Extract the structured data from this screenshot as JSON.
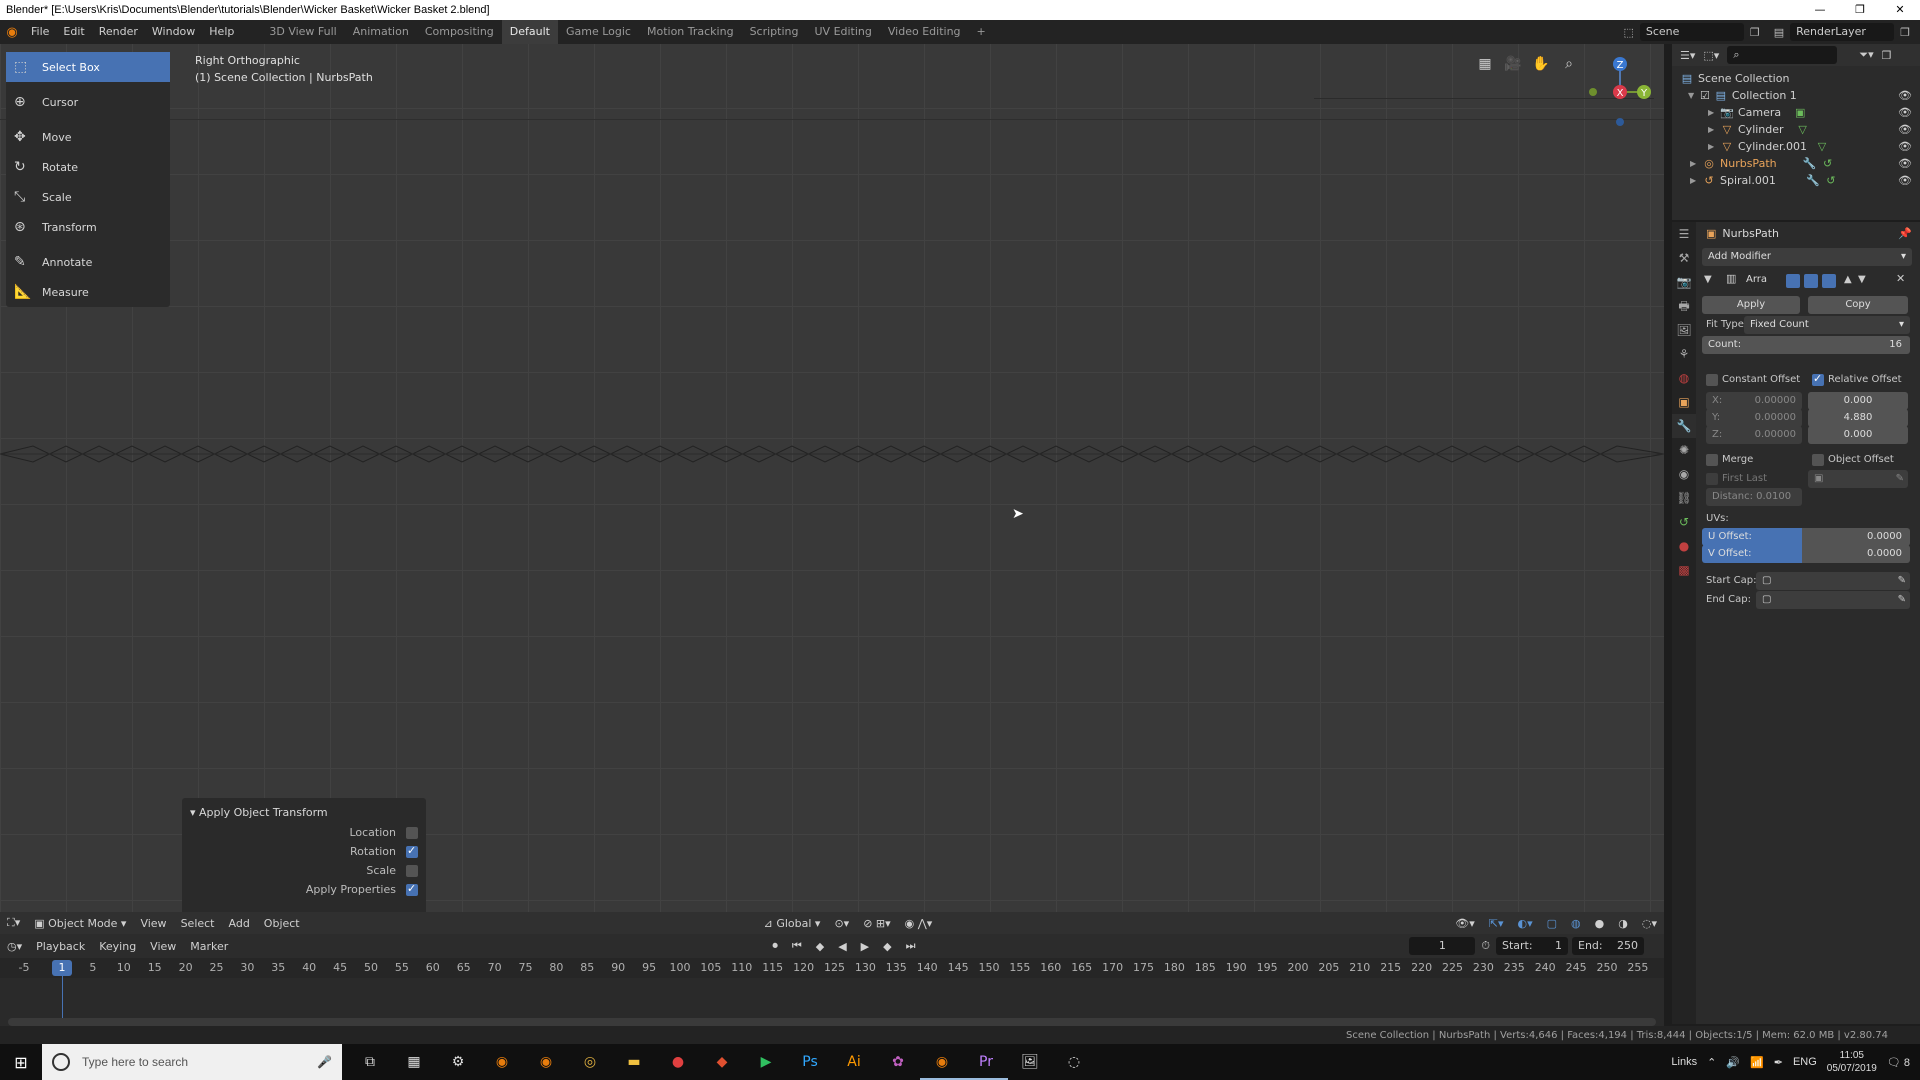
{
  "window": {
    "title": "Blender* [E:\\Users\\Kris\\Documents\\Blender\\tutorials\\Blender\\Wicker Basket\\Wicker Basket 2.blend]"
  },
  "menu": [
    "File",
    "Edit",
    "Render",
    "Window",
    "Help"
  ],
  "workspaces": [
    "3D View Full",
    "Animation",
    "Compositing",
    "Default",
    "Game Logic",
    "Motion Tracking",
    "Scripting",
    "UV Editing",
    "Video Editing",
    "+"
  ],
  "active_workspace_index": 3,
  "scene": {
    "name": "Scene",
    "render_layer": "RenderLayer"
  },
  "toolbar": {
    "items": [
      {
        "label": "Select Box",
        "icon": "select-box-icon"
      },
      {
        "label": "Cursor",
        "icon": "cursor-icon"
      },
      {
        "label": "Move",
        "icon": "move-icon"
      },
      {
        "label": "Rotate",
        "icon": "rotate-icon"
      },
      {
        "label": "Scale",
        "icon": "scale-icon"
      },
      {
        "label": "Transform",
        "icon": "transform-icon"
      },
      {
        "label": "Annotate",
        "icon": "annotate-icon"
      },
      {
        "label": "Measure",
        "icon": "measure-icon"
      }
    ]
  },
  "viewport": {
    "view_name": "Right Orthographic",
    "collection_info": "(1) Scene Collection | NurbsPath"
  },
  "gizmo": {
    "z": "Z",
    "y": "Y",
    "x": "X"
  },
  "redo_panel": {
    "title": "Apply Object Transform",
    "options": [
      {
        "label": "Location",
        "checked": false
      },
      {
        "label": "Rotation",
        "checked": true
      },
      {
        "label": "Scale",
        "checked": false
      },
      {
        "label": "Apply Properties",
        "checked": true
      }
    ]
  },
  "viewport_header": {
    "mode": "Object Mode",
    "items": [
      "View",
      "Select",
      "Add",
      "Object"
    ],
    "orientation": "Global"
  },
  "timeline_header": {
    "items": [
      "Playback",
      "Keying",
      "View",
      "Marker"
    ],
    "current_frame": "1",
    "start_label": "Start:",
    "start": "1",
    "end_label": "End:",
    "end": "250"
  },
  "timeline": {
    "ticks": [
      "-5",
      "1",
      "5",
      "10",
      "15",
      "20",
      "25",
      "30",
      "35",
      "40",
      "45",
      "50",
      "55",
      "60",
      "65",
      "70",
      "75",
      "80",
      "85",
      "90",
      "95",
      "100",
      "105",
      "110",
      "115",
      "120",
      "125",
      "130",
      "135",
      "140",
      "145",
      "150",
      "155",
      "160",
      "165",
      "170",
      "175",
      "180",
      "185",
      "190",
      "195",
      "200",
      "205",
      "210",
      "215",
      "220",
      "225",
      "230",
      "235",
      "240",
      "245",
      "250",
      "255"
    ],
    "playhead": "1"
  },
  "status": {
    "text": "Scene Collection | NurbsPath | Verts:4,646 | Faces:4,194 | Tris:8,444 | Objects:1/5 | Mem: 62.0 MB | v2.80.74"
  },
  "outliner": {
    "root": "Scene Collection",
    "collection": "Collection 1",
    "objects": [
      {
        "name": "Camera",
        "icon": "camera-icon",
        "selected": false
      },
      {
        "name": "Cylinder",
        "icon": "mesh-icon",
        "selected": false
      },
      {
        "name": "Cylinder.001",
        "icon": "mesh-icon",
        "selected": false
      },
      {
        "name": "NurbsPath",
        "icon": "curve-icon",
        "selected": true
      },
      {
        "name": "Spiral.001",
        "icon": "curve-icon",
        "selected": false
      }
    ]
  },
  "properties": {
    "object": "NurbsPath",
    "add_modifier": "Add Modifier",
    "modifier_name": "Arra",
    "apply": "Apply",
    "copy": "Copy",
    "fit_type_label": "Fit Type:",
    "fit_type": "Fixed Count",
    "count_label": "Count:",
    "count": "16",
    "constant_offset": "Constant Offset",
    "relative_offset": "Relative Offset",
    "const_x": "X:",
    "const_x_val": "0.00000",
    "const_y": "Y:",
    "const_y_val": "0.00000",
    "const_z": "Z:",
    "const_z_val": "0.00000",
    "rel_x": "0.000",
    "rel_y": "4.880",
    "rel_z": "0.000",
    "merge": "Merge",
    "object_offset": "Object Offset",
    "first_last": "First Last",
    "distance": "Distanc: 0.0100",
    "uvs": "UVs:",
    "u_offset_label": "U Offset:",
    "u_offset": "0.0000",
    "v_offset_label": "V Offset:",
    "v_offset": "0.0000",
    "start_cap": "Start Cap:",
    "end_cap": "End Cap:"
  },
  "taskbar": {
    "search_placeholder": "Type here to search",
    "links": "Links",
    "lang": "ENG",
    "time": "11:05",
    "date": "05/07/2019",
    "notifications": "8"
  },
  "colors": {
    "accent": "#4772b3",
    "selected_object": "#e8a35a",
    "viewport_bg": "#393939"
  }
}
